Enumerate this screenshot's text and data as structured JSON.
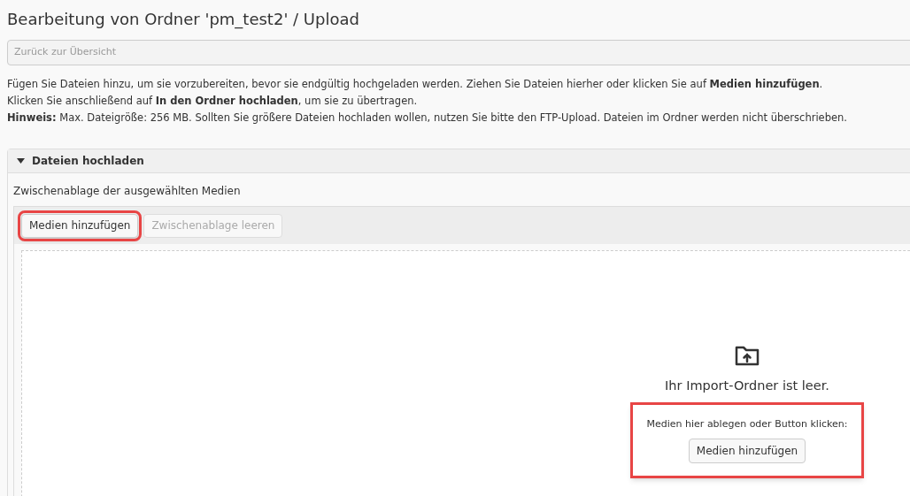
{
  "title": "Bearbeitung von Ordner 'pm_test2' / Upload",
  "back_button": "Zurück zur Übersicht",
  "instructions": [
    "Fügen Sie Dateien hinzu, um sie vorzubereiten, bevor sie endgültig hochgeladen werden. Ziehen Sie Dateien hierher oder klicken Sie auf **Medien hinzufügen**.",
    "Klicken Sie anschließend auf **In den Ordner hochladen**, um sie zu übertragen.",
    "**Hinweis:** Max. Dateigröße: 256 MB. Sollten Sie größere Dateien hochladen wollen, nutzen Sie bitte den FTP-Upload. Dateien im Ordner werden nicht überschrieben."
  ],
  "panel": {
    "title": "Dateien hochladen",
    "expanded": true,
    "clipboard_label": "Zwischenablage der ausgewählten Medien",
    "toolbar": [
      {
        "label": "Medien hinzufügen",
        "disabled": false,
        "highlighted": true
      },
      {
        "label": "Zwischenablage leeren",
        "disabled": true,
        "highlighted": false
      }
    ],
    "empty_state": {
      "message": "Ihr Import-Ordner ist leer.",
      "hint": "Medien hier ablegen oder Button klicken:",
      "button": "Medien hinzufügen",
      "highlighted": true
    }
  }
}
